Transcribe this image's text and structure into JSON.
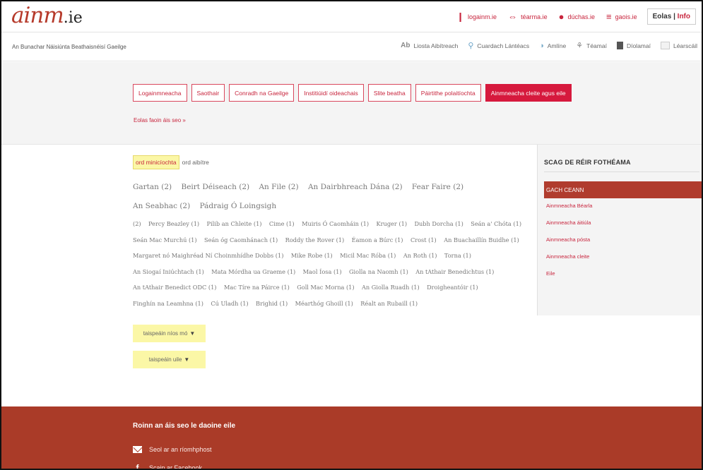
{
  "logo": {
    "text": "ainm",
    "suffix": ".ie"
  },
  "sites": [
    {
      "label": "logainm.ie",
      "icon": "logainm-icon"
    },
    {
      "label": "téarma.ie",
      "icon": "tearma-icon"
    },
    {
      "label": "dúchas.ie",
      "icon": "duchas-icon"
    },
    {
      "label": "gaois.ie",
      "icon": "gaois-icon"
    }
  ],
  "eolas": {
    "ga": "Eolas",
    "sep": "|",
    "en": "Info"
  },
  "nav": {
    "sitename": "An Bunachar Náisiúnta Beathaisnéisí Gaeilge",
    "links": [
      {
        "label": "Liosta Aibítreach",
        "icon": "ab-icon"
      },
      {
        "label": "Cuardach Lántéacs",
        "icon": "search-icon"
      },
      {
        "label": "Amlíne",
        "icon": "timeline-icon"
      },
      {
        "label": "Téamaí",
        "icon": "tree-icon"
      },
      {
        "label": "Díolamaí",
        "icon": "book-icon"
      },
      {
        "label": "Léarscáil",
        "icon": "map-icon"
      }
    ]
  },
  "categories": [
    "Logainmneacha",
    "Saothair",
    "Conradh na Gaeilge",
    "Institiúidí oideachais",
    "Slite beatha",
    "Páirtithe polaitíochta",
    "Ainmneacha cleite agus eile"
  ],
  "eolas_link": "Eolas faoin áis seo »",
  "sort": {
    "frequency": "ord minicíochta",
    "alpha": "ord aibítre"
  },
  "cloud_line1": [
    {
      "name": "Gartan",
      "count": "(2)"
    },
    {
      "name": "Beirt Déiseach",
      "count": "(2)"
    },
    {
      "name": "An File",
      "count": "(2)"
    },
    {
      "name": "An Dairbhreach Dána",
      "count": "(2)"
    },
    {
      "name": "Fear Faire",
      "count": "(2)"
    },
    {
      "name": "An Seabhac",
      "count": "(2)"
    },
    {
      "name": "Pádraig Ó Loingsigh",
      "count": ""
    }
  ],
  "cloud_rest": [
    {
      "name": "",
      "count": "(2)"
    },
    {
      "name": "Percy Beazley",
      "count": "(1)"
    },
    {
      "name": "Pilib an Chleite",
      "count": "(1)"
    },
    {
      "name": "Cime",
      "count": "(1)"
    },
    {
      "name": "Muiris Ó Caomháin",
      "count": "(1)"
    },
    {
      "name": "Kruger",
      "count": "(1)"
    },
    {
      "name": "Dubh Dorcha",
      "count": "(1)"
    },
    {
      "name": "Seán a' Chóta",
      "count": "(1)"
    },
    {
      "name": "Seán Mac Murchú",
      "count": "(1)"
    },
    {
      "name": "Seán óg Caomhánach",
      "count": "(1)"
    },
    {
      "name": "Roddy the Rover",
      "count": "(1)"
    },
    {
      "name": "Éamon a Búrc",
      "count": "(1)"
    },
    {
      "name": "Crost",
      "count": "(1)"
    },
    {
      "name": "An Buachaillín Buidhe",
      "count": "(1)"
    },
    {
      "name": "Margaret nó Maighréad Ní Choinmhídhe Dobbs",
      "count": "(1)"
    },
    {
      "name": "Mike Robe",
      "count": "(1)"
    },
    {
      "name": "Micil Mac Róba",
      "count": "(1)"
    },
    {
      "name": "An Roth",
      "count": "(1)"
    },
    {
      "name": "Torna",
      "count": "(1)"
    },
    {
      "name": "An Siogaí Iniúchtach",
      "count": "(1)"
    },
    {
      "name": "Mata Mórdha ua Graeme",
      "count": "(1)"
    },
    {
      "name": "Maol Íosa",
      "count": "(1)"
    },
    {
      "name": "Giolla na Naomh",
      "count": "(1)"
    },
    {
      "name": "An tAthair Benedichtus",
      "count": "(1)"
    },
    {
      "name": "An tAthair Benedict ODC",
      "count": "(1)"
    },
    {
      "name": "Mac Tíre na Páirce",
      "count": "(1)"
    },
    {
      "name": "Goll Mac Morna",
      "count": "(1)"
    },
    {
      "name": "An Giolla Ruadh",
      "count": "(1)"
    },
    {
      "name": "Droigheantóir",
      "count": "(1)"
    },
    {
      "name": "Finghín na Leamhna",
      "count": "(1)"
    },
    {
      "name": "Cú Uladh",
      "count": "(1)"
    },
    {
      "name": "Brighid",
      "count": "(1)"
    },
    {
      "name": "Méarthóg Ghoill",
      "count": "(1)"
    },
    {
      "name": "Réalt an Rubaill",
      "count": "(1)"
    }
  ],
  "buttons": {
    "more": "taispeáin níos mó",
    "all": "taispeáin uile",
    "arrow": "▼"
  },
  "sidebar": {
    "title": "SCAG DE RÉIR FOTHÉAMA",
    "all": "GACH CEANN",
    "items": [
      "Ainmneacha Béarla",
      "Ainmneacha áitiúla",
      "Ainmneacha pósta",
      "Ainmneacha cleite",
      "Eile"
    ]
  },
  "footer": {
    "title": "Roinn an áis seo le daoine eile",
    "email": "Seol ar an ríomhphost",
    "facebook": "Scaip ar Facebook"
  },
  "colors": {
    "accent": "#c8263e",
    "active_cat": "#d6193d",
    "footer": "#aa3b28",
    "highlight": "#fbf7a6"
  }
}
